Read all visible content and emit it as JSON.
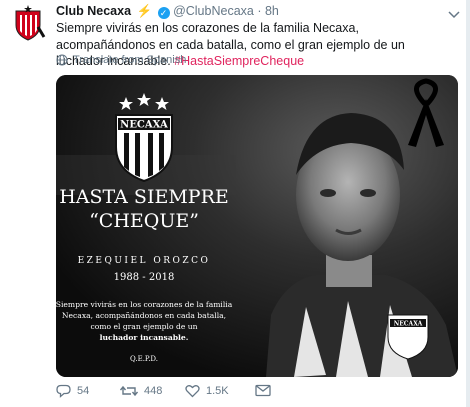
{
  "tweet": {
    "author_name": "Club Necaxa",
    "handle": "@ClubNecaxa",
    "separator": "·",
    "time": "8h",
    "text": "Siempre vivirás en los corazones de la familia Necaxa, acompañándonos en cada batalla, como el gran ejemplo de un luchador incansable.",
    "hashtag": "#HastaSiempreCheque",
    "translate_label": "Translate from Spanish"
  },
  "media": {
    "crest_text": "NECAXA",
    "headline_1": "HASTA SIEMPRE",
    "headline_2": "“CHEQUE”",
    "person_name": "EZEQUIEL OROZCO",
    "years": "1988 - 2018",
    "message_line_1": "Siempre vivirás en los corazones de la familia",
    "message_line_2": "Necaxa, acompañándonos en cada batalla,",
    "message_line_3": "como el gran ejemplo de un",
    "message_line_4": "luchador incansable.",
    "rip": "Q.E.P.D.",
    "jersey_crest_text": "NECAXA"
  },
  "actions": {
    "replies": "54",
    "retweets": "448",
    "likes": "1.5K"
  },
  "colors": {
    "hashtag": "#e0245e",
    "verified": "#1da1f2",
    "bolt": "#f2b100",
    "meta_gray": "#657786"
  }
}
